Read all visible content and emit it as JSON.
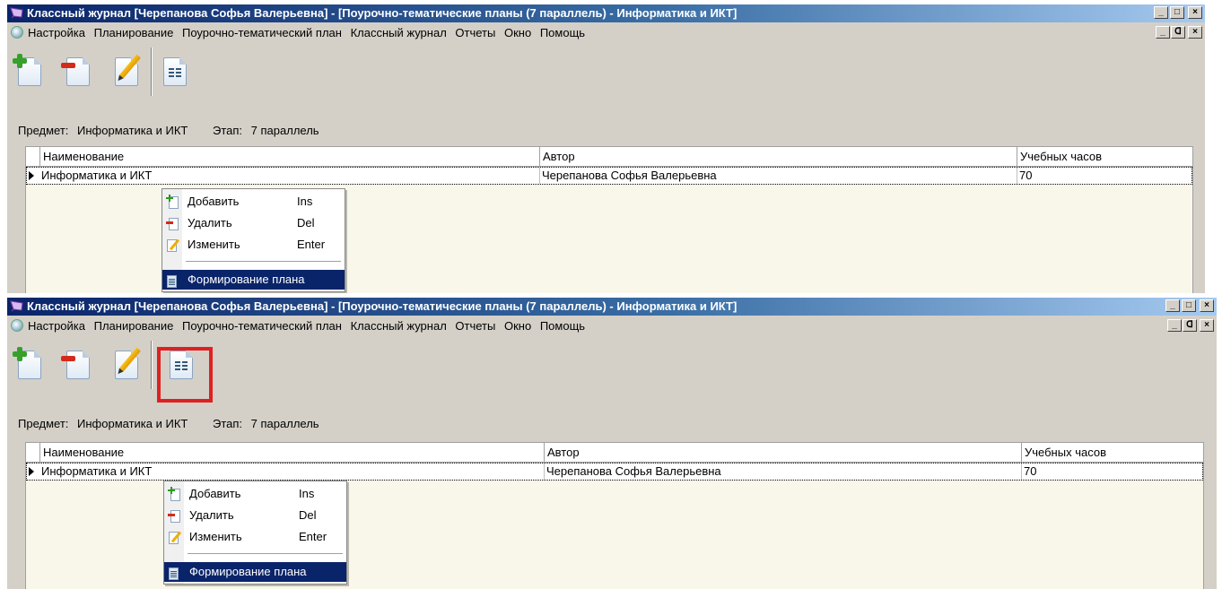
{
  "window": {
    "title": "Классный журнал [Черепанова  Софья  Валерьевна] - [Поурочно-тематические планы (7 параллель) - Информатика и ИКТ]",
    "caption_minimize": "_",
    "caption_maximize": "□",
    "caption_restore": "ᗡ",
    "caption_close": "×"
  },
  "menu": {
    "items": [
      "Настройка",
      "Планирование",
      "Поурочно-тематический план",
      "Классный журнал",
      "Отчеты",
      "Окно",
      "Помощь"
    ]
  },
  "toolbar": {
    "buttons": [
      "add-icon",
      "delete-icon",
      "edit-icon",
      "plan-icon"
    ]
  },
  "filter": {
    "subject_label": "Предмет:",
    "subject_value": "Информатика и ИКТ",
    "stage_label": "Этап:",
    "stage_value": "7 параллель"
  },
  "grid": {
    "columns": [
      "Наименование",
      "Автор",
      "Учебных часов"
    ],
    "rows": [
      {
        "name": "Информатика и ИКТ",
        "author": "Черепанова  Софья  Валерьевна",
        "hours": "70"
      }
    ]
  },
  "context_menu": {
    "items": [
      {
        "label": "Добавить",
        "shortcut": "Ins",
        "icon": "add-icon"
      },
      {
        "label": "Удалить",
        "shortcut": "Del",
        "icon": "delete-icon"
      },
      {
        "label": "Изменить",
        "shortcut": "Enter",
        "icon": "edit-icon"
      },
      {
        "label": "Формирование плана",
        "shortcut": "",
        "icon": "plan-icon",
        "selected": true
      }
    ]
  },
  "colors": {
    "title_start": "#0a246a",
    "title_end": "#a6caf0",
    "window_bg": "#d4d0c8",
    "grid_bg": "#f9f7ea",
    "highlight_box": "#e02020",
    "menu_selection": "#0a246a"
  }
}
